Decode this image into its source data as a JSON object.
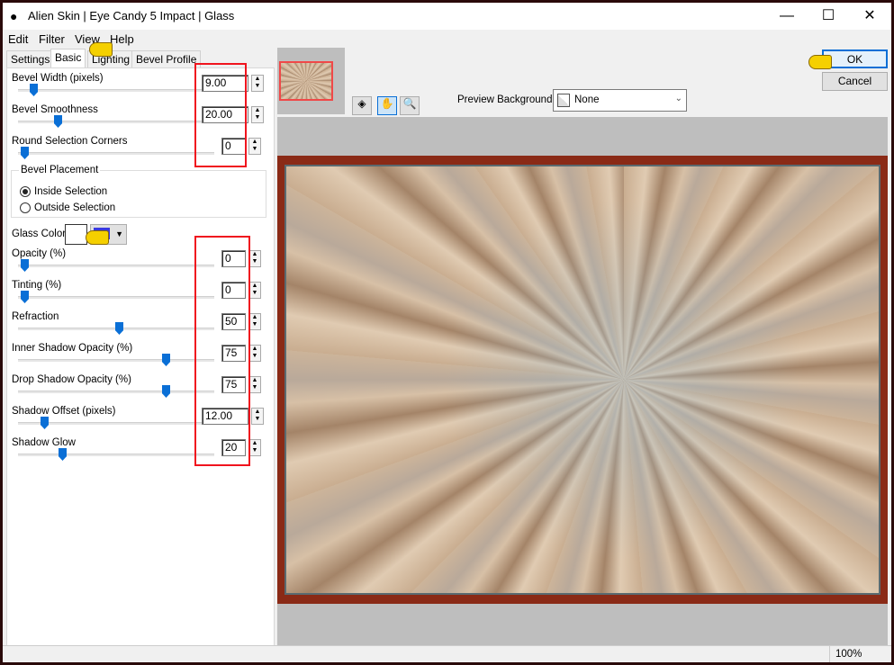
{
  "window": {
    "title": "Alien Skin | Eye Candy 5 Impact | Glass",
    "minimize": "—",
    "maximize": "☐",
    "close": "✕"
  },
  "menu": [
    "Edit",
    "Filter",
    "View",
    "Help"
  ],
  "tabs": [
    "Settings",
    "Basic",
    "Lighting",
    "Bevel Profile"
  ],
  "active_tab": "Basic",
  "controls": [
    {
      "label": "Bevel Width (pixels)",
      "value": "9.00"
    },
    {
      "label": "Bevel Smoothness",
      "value": "20.00"
    },
    {
      "label": "Round Selection Corners",
      "value": "0"
    },
    {
      "label": "Opacity (%)",
      "value": "0"
    },
    {
      "label": "Tinting (%)",
      "value": "0"
    },
    {
      "label": "Refraction",
      "value": "50"
    },
    {
      "label": "Inner Shadow Opacity (%)",
      "value": "75"
    },
    {
      "label": "Drop Shadow Opacity (%)",
      "value": "75"
    },
    {
      "label": "Shadow Offset (pixels)",
      "value": "12.00"
    },
    {
      "label": "Shadow Glow",
      "value": "20"
    }
  ],
  "bevel_placement": {
    "title": "Bevel Placement",
    "options": [
      "Inside Selection",
      "Outside Selection"
    ],
    "selected": "Inside Selection"
  },
  "glass_color": {
    "label": "Glass Color",
    "color": "#ffffff"
  },
  "buttons": {
    "ok": "OK",
    "cancel": "Cancel"
  },
  "preview_background": {
    "label": "Preview Background:",
    "value": "None"
  },
  "status": {
    "zoom": "100%"
  },
  "highlight_color": "#f0141e",
  "accent": "#0a6fd6"
}
